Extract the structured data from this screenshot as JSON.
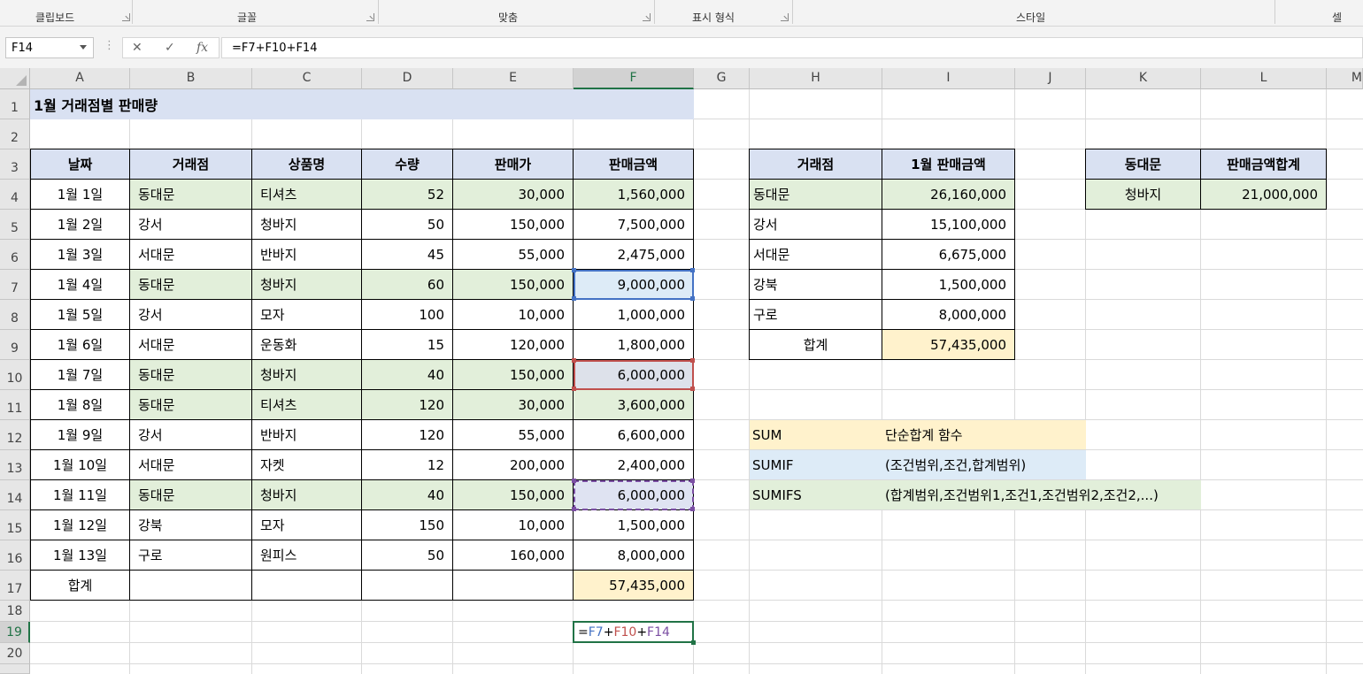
{
  "ribbon": {
    "groups": [
      "클립보드",
      "글꼴",
      "맞춤",
      "표시 형식",
      "스타일",
      "셀"
    ]
  },
  "formula_bar": {
    "name_box": "F14",
    "formula": "=F7+F10+F14"
  },
  "columns": [
    "A",
    "B",
    "C",
    "D",
    "E",
    "F",
    "G",
    "H",
    "I",
    "J",
    "K",
    "L",
    "M"
  ],
  "rows": [
    "1",
    "2",
    "3",
    "4",
    "5",
    "6",
    "7",
    "8",
    "9",
    "10",
    "11",
    "12",
    "13",
    "14",
    "15",
    "16",
    "17",
    "18",
    "19",
    "20"
  ],
  "sheet": {
    "title": "1월 거래점별 판매량",
    "headers": [
      "날짜",
      "거래점",
      "상품명",
      "수량",
      "판매가",
      "판매금액"
    ],
    "rows": [
      [
        "1월 1일",
        "동대문",
        "티셔츠",
        "52",
        "30,000",
        "1,560,000"
      ],
      [
        "1월 2일",
        "강서",
        "청바지",
        "50",
        "150,000",
        "7,500,000"
      ],
      [
        "1월 3일",
        "서대문",
        "반바지",
        "45",
        "55,000",
        "2,475,000"
      ],
      [
        "1월 4일",
        "동대문",
        "청바지",
        "60",
        "150,000",
        "9,000,000"
      ],
      [
        "1월 5일",
        "강서",
        "모자",
        "100",
        "10,000",
        "1,000,000"
      ],
      [
        "1월 6일",
        "서대문",
        "운동화",
        "15",
        "120,000",
        "1,800,000"
      ],
      [
        "1월 7일",
        "동대문",
        "청바지",
        "40",
        "150,000",
        "6,000,000"
      ],
      [
        "1월 8일",
        "동대문",
        "티셔츠",
        "120",
        "30,000",
        "3,600,000"
      ],
      [
        "1월 9일",
        "강서",
        "반바지",
        "120",
        "55,000",
        "6,600,000"
      ],
      [
        "1월 10일",
        "서대문",
        "자켓",
        "12",
        "200,000",
        "2,400,000"
      ],
      [
        "1월 11일",
        "동대문",
        "청바지",
        "40",
        "150,000",
        "6,000,000"
      ],
      [
        "1월 12일",
        "강북",
        "모자",
        "150",
        "10,000",
        "1,500,000"
      ],
      [
        "1월 13일",
        "구로",
        "원피스",
        "50",
        "160,000",
        "8,000,000"
      ]
    ],
    "total_label": "합계",
    "total_value": "57,435,000",
    "editing_cell": {
      "prefix": "=",
      "r1": "F7",
      "p1": "+",
      "r2": "F10",
      "p2": "+",
      "r3": "F14"
    }
  },
  "summary": {
    "headers": [
      "거래점",
      "1월 판매금액"
    ],
    "rows": [
      [
        "동대문",
        "26,160,000"
      ],
      [
        "강서",
        "15,100,000"
      ],
      [
        "서대문",
        "6,675,000"
      ],
      [
        "강북",
        "1,500,000"
      ],
      [
        "구로",
        "8,000,000"
      ]
    ],
    "total_label": "합계",
    "total_value": "57,435,000"
  },
  "notes": [
    {
      "name": "SUM",
      "desc": "단순합계 함수"
    },
    {
      "name": "SUMIF",
      "desc": "(조건범위,조건,합계범위)"
    },
    {
      "name": "SUMIFS",
      "desc": "(합계범위,조건범위1,조건1,조건범위2,조건2,...)"
    }
  ],
  "criteria": {
    "headers": [
      "동대문",
      "판매금액합계"
    ],
    "product": "청바지",
    "amount": "21,000,000"
  },
  "colors": {
    "header_fill": "#d9e1f2",
    "green_fill": "#e2efda",
    "yellow_fill": "#fff2cc",
    "blue_fill": "#ddebf7",
    "ref_blue": "#4472c4",
    "ref_red": "#c0504d",
    "ref_purple": "#7b4fa3",
    "excel_green": "#217346"
  }
}
